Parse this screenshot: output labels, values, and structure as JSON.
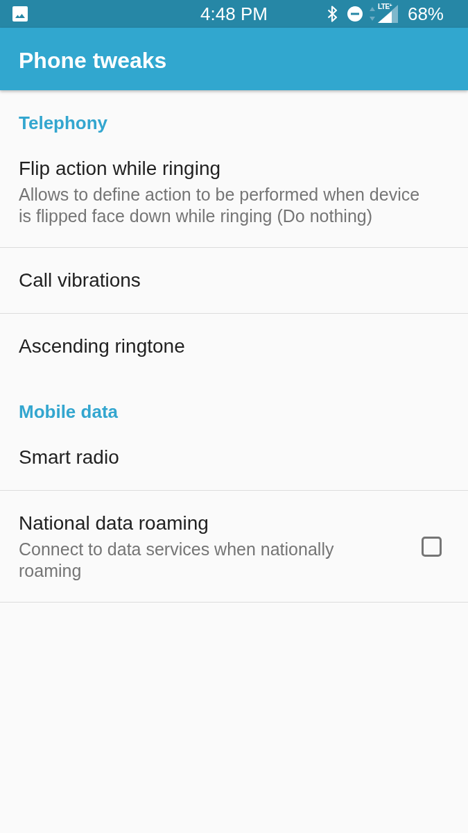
{
  "status_bar": {
    "time": "4:48 PM",
    "network_label": "LTE$^{+}$",
    "battery": "68%"
  },
  "app_bar": {
    "title": "Phone tweaks"
  },
  "sections": [
    {
      "title": "Telephony",
      "items": [
        {
          "kind": "plain",
          "title": "Flip action while ringing",
          "summary": "Allows to define action to be performed when device is flipped face down while ringing (Do nothing)"
        },
        {
          "kind": "plain",
          "title": "Call vibrations"
        },
        {
          "kind": "plain",
          "title": "Ascending ringtone"
        }
      ]
    },
    {
      "title": "Mobile data",
      "items": [
        {
          "kind": "plain",
          "title": "Smart radio"
        },
        {
          "kind": "checkbox",
          "title": "National data roaming",
          "summary": "Connect to data services when nationally roaming",
          "checked": false
        }
      ]
    }
  ]
}
